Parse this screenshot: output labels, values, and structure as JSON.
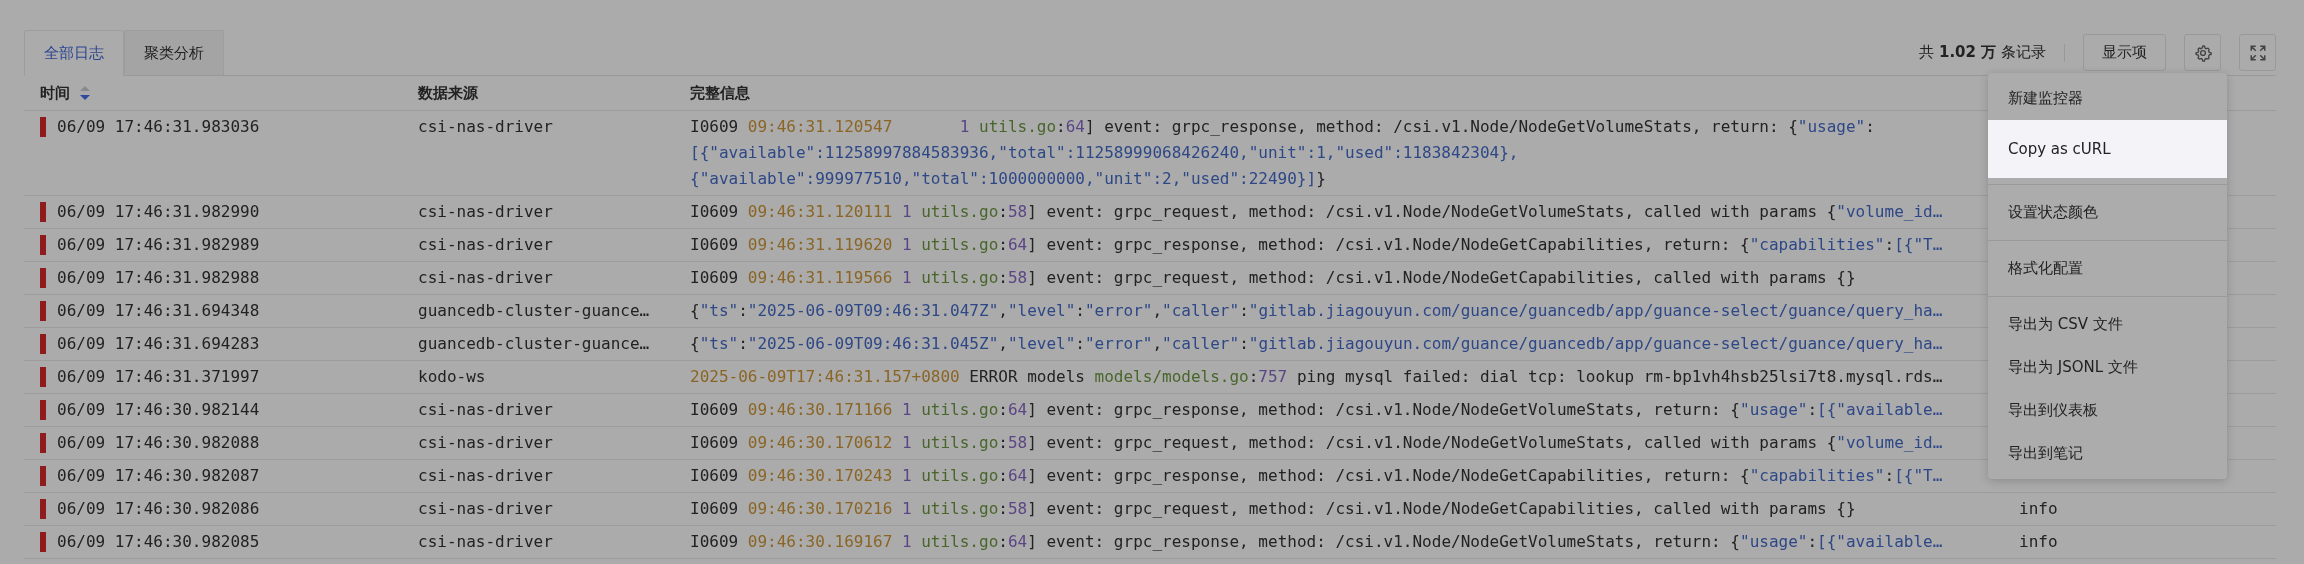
{
  "tabs": [
    {
      "label": "全部日志",
      "selected": true
    },
    {
      "label": "聚类分析",
      "selected": false
    }
  ],
  "toolbar": {
    "record_count": "共 **1.02 万** 条记录",
    "display_button": "显示项"
  },
  "table": {
    "columns": [
      {
        "label": "时间",
        "sort_descending": true
      },
      {
        "label": "数据来源"
      },
      {
        "label": "完整信息"
      }
    ],
    "rows": [
      {
        "time": "06/09 17:46:31.983036",
        "source": "csi-nas-driver",
        "lines": [
          [
            {
              "kind": "plain",
              "text": "I0609 "
            },
            {
              "kind": "time",
              "text": "09:46:31.120547"
            },
            {
              "kind": "num",
              "text": "       1"
            },
            {
              "kind": "file",
              "text": " utils.go"
            },
            {
              "kind": "plain",
              "text": ":"
            },
            {
              "kind": "num",
              "text": "64"
            },
            {
              "kind": "plain",
              "text": "] event: grpc_response, method: /csi.v1.Node/NodeGetVolumeStats, return: {"
            },
            {
              "kind": "str",
              "text": "\"usage\""
            },
            {
              "kind": "plain",
              "text": ":"
            }
          ],
          [
            {
              "kind": "str",
              "text": "[{\"available\":11258997884583936,\"total\":11258999068426240,\"unit\":1,\"used\":1183842304},"
            }
          ],
          [
            {
              "kind": "str",
              "text": "{\"available\":999977510,\"total\":1000000000,\"unit\":2,\"used\":22490}]"
            },
            {
              "kind": "plain",
              "text": "}"
            }
          ]
        ]
      },
      {
        "time": "06/09 17:46:31.982990",
        "source": "csi-nas-driver",
        "lines": [
          [
            {
              "kind": "plain",
              "text": "I0609 "
            },
            {
              "kind": "time",
              "text": "09:46:31.120111"
            },
            {
              "kind": "num",
              "text": " 1"
            },
            {
              "kind": "file",
              "text": " utils.go"
            },
            {
              "kind": "plain",
              "text": ":"
            },
            {
              "kind": "num",
              "text": "58"
            },
            {
              "kind": "plain",
              "text": "] event: grpc_request, method: /csi.v1.Node/NodeGetVolumeStats, called with params {"
            },
            {
              "kind": "str",
              "text": "\"volume_id…"
            }
          ]
        ]
      },
      {
        "time": "06/09 17:46:31.982989",
        "source": "csi-nas-driver",
        "lines": [
          [
            {
              "kind": "plain",
              "text": "I0609 "
            },
            {
              "kind": "time",
              "text": "09:46:31.119620"
            },
            {
              "kind": "num",
              "text": " 1"
            },
            {
              "kind": "file",
              "text": " utils.go"
            },
            {
              "kind": "plain",
              "text": ":"
            },
            {
              "kind": "num",
              "text": "64"
            },
            {
              "kind": "plain",
              "text": "] event: grpc_response, method: /csi.v1.Node/NodeGetCapabilities, return: {"
            },
            {
              "kind": "str",
              "text": "\"capabilities\""
            },
            {
              "kind": "plain",
              "text": ":"
            },
            {
              "kind": "str",
              "text": "[{\"T…"
            }
          ]
        ]
      },
      {
        "time": "06/09 17:46:31.982988",
        "source": "csi-nas-driver",
        "lines": [
          [
            {
              "kind": "plain",
              "text": "I0609 "
            },
            {
              "kind": "time",
              "text": "09:46:31.119566"
            },
            {
              "kind": "num",
              "text": " 1"
            },
            {
              "kind": "file",
              "text": " utils.go"
            },
            {
              "kind": "plain",
              "text": ":"
            },
            {
              "kind": "num",
              "text": "58"
            },
            {
              "kind": "plain",
              "text": "] event: grpc_request, method: /csi.v1.Node/NodeGetCapabilities, called with params {}"
            }
          ]
        ]
      },
      {
        "time": "06/09 17:46:31.694348",
        "source": "guancedb-cluster-guance…",
        "lines": [
          [
            {
              "kind": "plain",
              "text": "{"
            },
            {
              "kind": "str",
              "text": "\"ts\""
            },
            {
              "kind": "plain",
              "text": ":"
            },
            {
              "kind": "str",
              "text": "\"2025-06-09T09:46:31.047Z\""
            },
            {
              "kind": "plain",
              "text": ","
            },
            {
              "kind": "str",
              "text": "\"level\""
            },
            {
              "kind": "plain",
              "text": ":"
            },
            {
              "kind": "str",
              "text": "\"error\""
            },
            {
              "kind": "plain",
              "text": ","
            },
            {
              "kind": "str",
              "text": "\"caller\""
            },
            {
              "kind": "plain",
              "text": ":"
            },
            {
              "kind": "str",
              "text": "\"gitlab.jiagouyun.com/guance/guancedb/app/guance-select/guance/query_ha…"
            }
          ]
        ]
      },
      {
        "time": "06/09 17:46:31.694283",
        "source": "guancedb-cluster-guance…",
        "lines": [
          [
            {
              "kind": "plain",
              "text": "{"
            },
            {
              "kind": "str",
              "text": "\"ts\""
            },
            {
              "kind": "plain",
              "text": ":"
            },
            {
              "kind": "str",
              "text": "\"2025-06-09T09:46:31.045Z\""
            },
            {
              "kind": "plain",
              "text": ","
            },
            {
              "kind": "str",
              "text": "\"level\""
            },
            {
              "kind": "plain",
              "text": ":"
            },
            {
              "kind": "str",
              "text": "\"error\""
            },
            {
              "kind": "plain",
              "text": ","
            },
            {
              "kind": "str",
              "text": "\"caller\""
            },
            {
              "kind": "plain",
              "text": ":"
            },
            {
              "kind": "str",
              "text": "\"gitlab.jiagouyun.com/guance/guancedb/app/guance-select/guance/query_ha…"
            }
          ]
        ]
      },
      {
        "time": "06/09 17:46:31.371997",
        "source": "kodo-ws",
        "lines": [
          [
            {
              "kind": "time",
              "text": "2025-06-09T17:46:31.157+0800"
            },
            {
              "kind": "plain",
              "text": " ERROR models "
            },
            {
              "kind": "file",
              "text": "models/models.go"
            },
            {
              "kind": "plain",
              "text": ":"
            },
            {
              "kind": "num",
              "text": "757"
            },
            {
              "kind": "plain",
              "text": " ping mysql failed: dial tcp: lookup rm-bp1vh4hsb25lsi7t8.mysql.rds…"
            }
          ]
        ]
      },
      {
        "time": "06/09 17:46:30.982144",
        "source": "csi-nas-driver",
        "lines": [
          [
            {
              "kind": "plain",
              "text": "I0609 "
            },
            {
              "kind": "time",
              "text": "09:46:30.171166"
            },
            {
              "kind": "num",
              "text": " 1"
            },
            {
              "kind": "file",
              "text": " utils.go"
            },
            {
              "kind": "plain",
              "text": ":"
            },
            {
              "kind": "num",
              "text": "64"
            },
            {
              "kind": "plain",
              "text": "] event: grpc_response, method: /csi.v1.Node/NodeGetVolumeStats, return: {"
            },
            {
              "kind": "str",
              "text": "\"usage\""
            },
            {
              "kind": "plain",
              "text": ":"
            },
            {
              "kind": "str",
              "text": "[{\"available…"
            }
          ]
        ]
      },
      {
        "time": "06/09 17:46:30.982088",
        "source": "csi-nas-driver",
        "lines": [
          [
            {
              "kind": "plain",
              "text": "I0609 "
            },
            {
              "kind": "time",
              "text": "09:46:30.170612"
            },
            {
              "kind": "num",
              "text": " 1"
            },
            {
              "kind": "file",
              "text": " utils.go"
            },
            {
              "kind": "plain",
              "text": ":"
            },
            {
              "kind": "num",
              "text": "58"
            },
            {
              "kind": "plain",
              "text": "] event: grpc_request, method: /csi.v1.Node/NodeGetVolumeStats, called with params {"
            },
            {
              "kind": "str",
              "text": "\"volume_id…"
            }
          ]
        ]
      },
      {
        "time": "06/09 17:46:30.982087",
        "source": "csi-nas-driver",
        "lines": [
          [
            {
              "kind": "plain",
              "text": "I0609 "
            },
            {
              "kind": "time",
              "text": "09:46:30.170243"
            },
            {
              "kind": "num",
              "text": " 1"
            },
            {
              "kind": "file",
              "text": " utils.go"
            },
            {
              "kind": "plain",
              "text": ":"
            },
            {
              "kind": "num",
              "text": "64"
            },
            {
              "kind": "plain",
              "text": "] event: grpc_response, method: /csi.v1.Node/NodeGetCapabilities, return: {"
            },
            {
              "kind": "str",
              "text": "\"capabilities\""
            },
            {
              "kind": "plain",
              "text": ":"
            },
            {
              "kind": "str",
              "text": "[{\"T…"
            }
          ]
        ]
      },
      {
        "time": "06/09 17:46:30.982086",
        "source": "csi-nas-driver",
        "column_4": "info",
        "lines": [
          [
            {
              "kind": "plain",
              "text": "I0609 "
            },
            {
              "kind": "time",
              "text": "09:46:30.170216"
            },
            {
              "kind": "num",
              "text": " 1"
            },
            {
              "kind": "file",
              "text": " utils.go"
            },
            {
              "kind": "plain",
              "text": ":"
            },
            {
              "kind": "num",
              "text": "58"
            },
            {
              "kind": "plain",
              "text": "] event: grpc_request, method: /csi.v1.Node/NodeGetCapabilities, called with params {}"
            }
          ]
        ]
      },
      {
        "time": "06/09 17:46:30.982085",
        "source": "csi-nas-driver",
        "column_4": "info",
        "lines": [
          [
            {
              "kind": "plain",
              "text": "I0609 "
            },
            {
              "kind": "time",
              "text": "09:46:30.169167"
            },
            {
              "kind": "num",
              "text": " 1"
            },
            {
              "kind": "file",
              "text": " utils.go"
            },
            {
              "kind": "plain",
              "text": ":"
            },
            {
              "kind": "num",
              "text": "64"
            },
            {
              "kind": "plain",
              "text": "] event: grpc_response, method: /csi.v1.Node/NodeGetVolumeStats, return: {"
            },
            {
              "kind": "str",
              "text": "\"usage\""
            },
            {
              "kind": "plain",
              "text": ":"
            },
            {
              "kind": "str",
              "text": "[{\"available…"
            }
          ]
        ]
      }
    ]
  },
  "menu": {
    "groups": [
      [
        {
          "label": "新建监控器",
          "highlighted": false
        },
        {
          "label": "Copy as cURL",
          "highlighted": true
        }
      ],
      [
        {
          "label": "设置状态颜色",
          "highlighted": false
        }
      ],
      [
        {
          "label": "格式化配置",
          "highlighted": false
        }
      ],
      [
        {
          "label": "导出为 CSV 文件",
          "highlighted": false
        },
        {
          "label": "导出为 JSONL 文件",
          "highlighted": false
        },
        {
          "label": "导出到仪表板",
          "highlighted": false
        },
        {
          "label": "导出到笔记",
          "highlighted": false
        }
      ]
    ]
  }
}
